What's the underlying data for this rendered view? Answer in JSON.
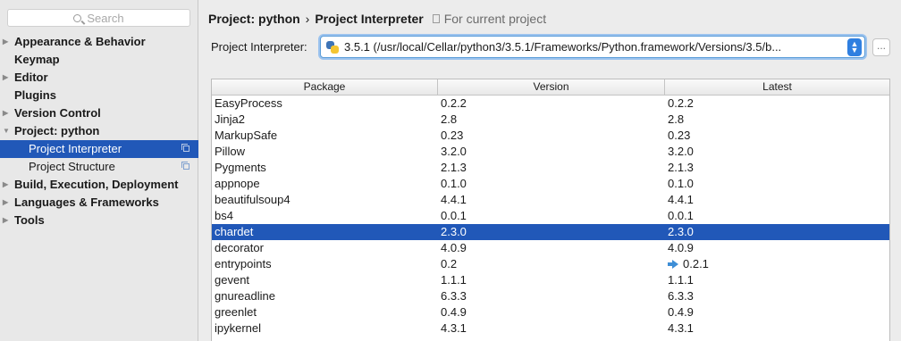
{
  "sidebar": {
    "search_placeholder": "Search",
    "items": [
      {
        "label": "Appearance & Behavior",
        "arrow": "▶"
      },
      {
        "label": "Keymap",
        "arrow": ""
      },
      {
        "label": "Editor",
        "arrow": "▶"
      },
      {
        "label": "Plugins",
        "arrow": ""
      },
      {
        "label": "Version Control",
        "arrow": "▶"
      },
      {
        "label": "Project: python",
        "arrow": "▼"
      },
      {
        "label": "Project Interpreter",
        "arrow": ""
      },
      {
        "label": "Project Structure",
        "arrow": ""
      },
      {
        "label": "Build, Execution, Deployment",
        "arrow": "▶"
      },
      {
        "label": "Languages & Frameworks",
        "arrow": "▶"
      },
      {
        "label": "Tools",
        "arrow": "▶"
      }
    ]
  },
  "breadcrumb": {
    "parent": "Project: python",
    "separator": "›",
    "current": "Project Interpreter",
    "scope": "For current project"
  },
  "interpreter": {
    "label": "Project Interpreter:",
    "value": "3.5.1 (/usr/local/Cellar/python3/3.5.1/Frameworks/Python.framework/Versions/3.5/b...",
    "more_label": "..."
  },
  "table": {
    "headers": [
      "Package",
      "Version",
      "Latest"
    ],
    "rows": [
      {
        "package": "EasyProcess",
        "version": "0.2.2",
        "latest": "0.2.2"
      },
      {
        "package": "Jinja2",
        "version": "2.8",
        "latest": "2.8"
      },
      {
        "package": "MarkupSafe",
        "version": "0.23",
        "latest": "0.23"
      },
      {
        "package": "Pillow",
        "version": "3.2.0",
        "latest": "3.2.0"
      },
      {
        "package": "Pygments",
        "version": "2.1.3",
        "latest": "2.1.3"
      },
      {
        "package": "appnope",
        "version": "0.1.0",
        "latest": "0.1.0"
      },
      {
        "package": "beautifulsoup4",
        "version": "4.4.1",
        "latest": "4.4.1"
      },
      {
        "package": "bs4",
        "version": "0.0.1",
        "latest": "0.0.1"
      },
      {
        "package": "chardet",
        "version": "2.3.0",
        "latest": "2.3.0"
      },
      {
        "package": "decorator",
        "version": "4.0.9",
        "latest": "4.0.9"
      },
      {
        "package": "entrypoints",
        "version": "0.2",
        "latest": "0.2.1"
      },
      {
        "package": "gevent",
        "version": "1.1.1",
        "latest": "1.1.1"
      },
      {
        "package": "gnureadline",
        "version": "6.3.3",
        "latest": "6.3.3"
      },
      {
        "package": "greenlet",
        "version": "0.4.9",
        "latest": "0.4.9"
      },
      {
        "package": "ipykernel",
        "version": "4.3.1",
        "latest": "4.3.1"
      }
    ]
  },
  "colors": {
    "selection": "#2158b8",
    "focus_ring": "#5b9dd9",
    "update_arrow": "#3e8ed6"
  }
}
